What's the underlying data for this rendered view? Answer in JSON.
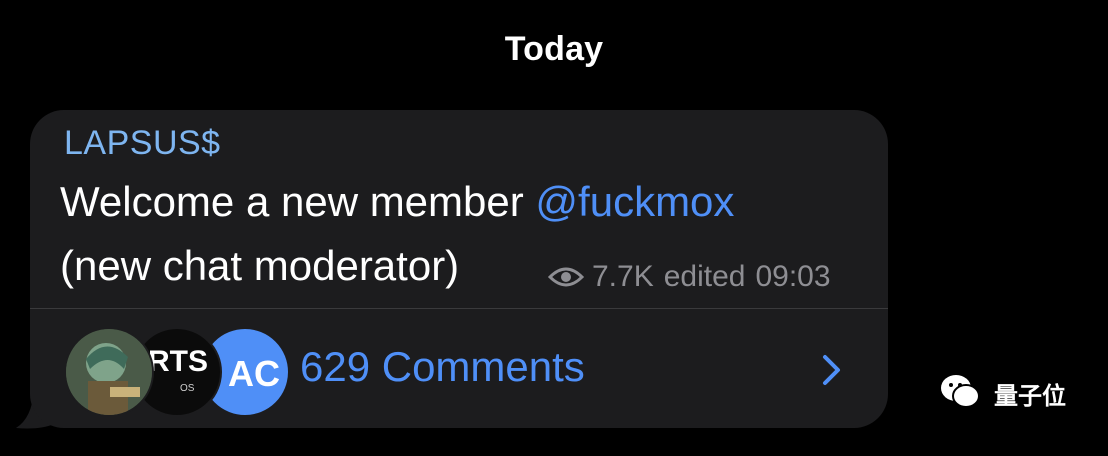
{
  "date_separator": "Today",
  "message": {
    "sender": "LAPSUS$",
    "line1_prefix": "Welcome a new member ",
    "mention": "@fuckmox",
    "line2": "(new chat moderator)",
    "views": "7.7K",
    "edited_label": "edited",
    "time": "09:03"
  },
  "comments": {
    "label": "629 Comments",
    "avatars": [
      {
        "name": "anime-character-avatar"
      },
      {
        "name": "rts-logo-avatar",
        "text": "RTS",
        "subtext": "OS"
      },
      {
        "name": "initials-avatar",
        "text": "AC",
        "color": "#4f8ff7"
      }
    ],
    "icon": "chevron-right-icon"
  },
  "colors": {
    "background": "#000000",
    "bubble": "#1c1c1e",
    "sender": "#7eb5f0",
    "link": "#4f8ff7",
    "meta": "#8e8e93"
  },
  "watermark": {
    "icon": "wechat-icon",
    "text": "量子位"
  }
}
